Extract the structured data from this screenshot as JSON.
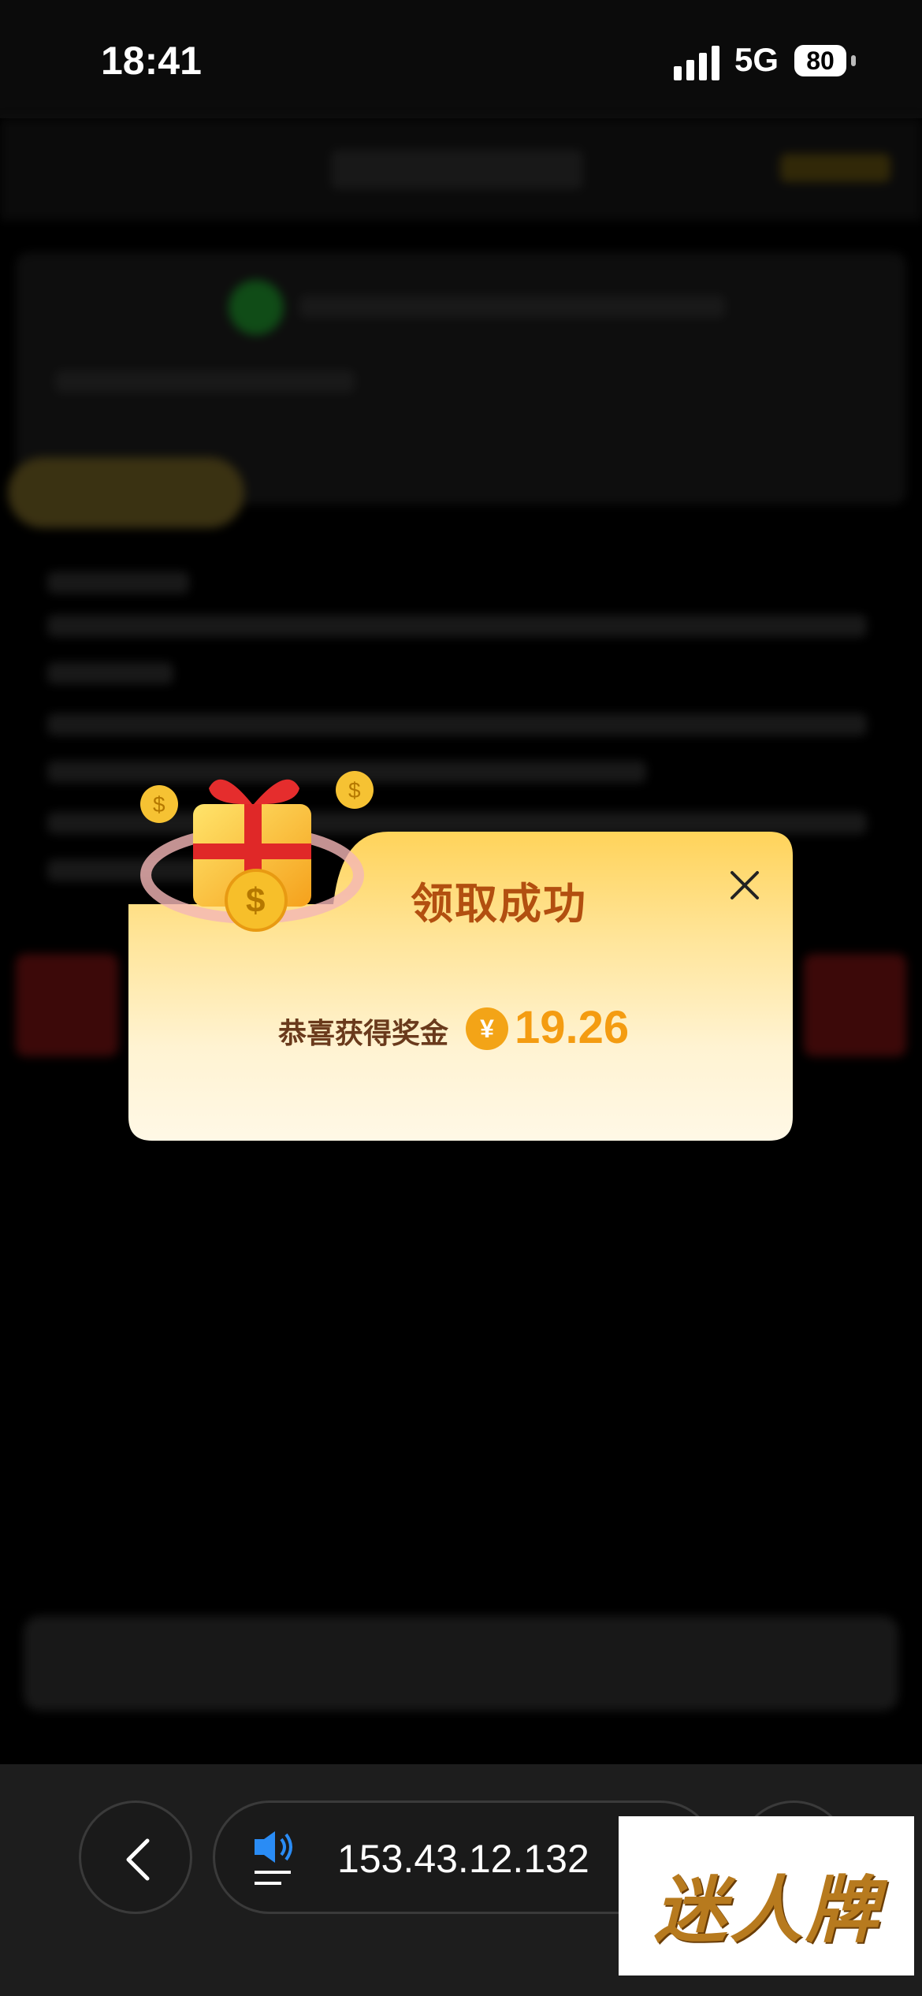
{
  "status_bar": {
    "time": "18:41",
    "network": "5G",
    "battery": "80"
  },
  "modal": {
    "title": "领取成功",
    "reward_label": "恭喜获得奖金",
    "currency_symbol": "¥",
    "reward_amount": "19.26"
  },
  "browser": {
    "url": "153.43.12.132"
  },
  "watermark": {
    "text": "迷人牌"
  },
  "icons": {
    "gift": "gift-box-icon",
    "close": "close-icon",
    "back": "chevron-left-icon",
    "speaker": "speaker-icon"
  },
  "colors": {
    "modal_title": "#b24f10",
    "reward_amount": "#f49c11",
    "yuan_badge": "#f3a417"
  }
}
